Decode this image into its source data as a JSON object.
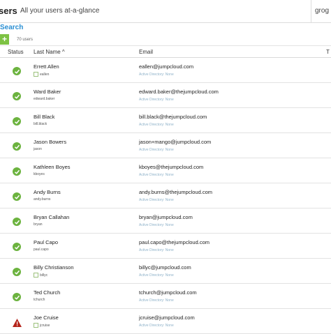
{
  "header": {
    "title": "sers",
    "subtitle": "All your users at-a-glance",
    "right_tab": "grog"
  },
  "toolbar": {
    "search_label": "Search",
    "add_label": "+",
    "user_count": "70 users"
  },
  "table": {
    "columns": {
      "status": "Status",
      "last_name": "Last Name ^",
      "email": "Email",
      "extra": "T"
    },
    "ad_prefix": "Active Directory:",
    "rows": [
      {
        "name": "Errett Allen",
        "username": "eallen",
        "email": "eallen@jumpcloud.com",
        "ad": "Active Directory: None",
        "status": "ok",
        "user_icon": true
      },
      {
        "name": "Ward Baker",
        "username": "edward.baker",
        "email": "edward.baker@thejumpcloud.com",
        "ad": "Active Directory: None",
        "status": "ok",
        "user_icon": false
      },
      {
        "name": "Bill Black",
        "username": "bill.black",
        "email": "bill.black@thejumpcloud.com",
        "ad": "Active Directory: None",
        "status": "ok",
        "user_icon": false
      },
      {
        "name": "Jason Bowers",
        "username": "jason",
        "email": "jason+mango@jumpcloud.com",
        "ad": "Active Directory: None",
        "status": "ok",
        "user_icon": false
      },
      {
        "name": "Kathleen Boyes",
        "username": "kboyes",
        "email": "kboyes@thejumpcloud.com",
        "ad": "Active Directory: None",
        "status": "ok",
        "user_icon": false
      },
      {
        "name": "Andy Burns",
        "username": "andy.burns",
        "email": "andy.burns@thejumpcloud.com",
        "ad": "Active Directory: None",
        "status": "ok",
        "user_icon": false
      },
      {
        "name": "Bryan Callahan",
        "username": "bryan",
        "email": "bryan@jumpcloud.com",
        "ad": "Active Directory: None",
        "status": "ok",
        "user_icon": false
      },
      {
        "name": "Paul Capo",
        "username": "paul.capo",
        "email": "paul.capo@thejumpcloud.com",
        "ad": "Active Directory: None",
        "status": "ok",
        "user_icon": false
      },
      {
        "name": "Billy Christianson",
        "username": "billyc",
        "email": "billyc@jumpcloud.com",
        "ad": "Active Directory: None",
        "status": "ok",
        "user_icon": true
      },
      {
        "name": "Ted Church",
        "username": "tchurch",
        "email": "tchurch@jumpcloud.com",
        "ad": "Active Directory: None",
        "status": "ok",
        "user_icon": false
      },
      {
        "name": "Joe Cruise",
        "username": "jcruise",
        "email": "jcruise@jumpcloud.com",
        "ad": "Active Directory: None",
        "status": "warning",
        "user_icon": true
      }
    ]
  },
  "colors": {
    "ok": "#6cb33f",
    "warning": "#b5241b",
    "link": "#2a8fd3",
    "add": "#7dc243"
  },
  "icons": {
    "ok": "check-circle-icon",
    "warning": "warning-triangle-icon",
    "user": "user-icon"
  }
}
